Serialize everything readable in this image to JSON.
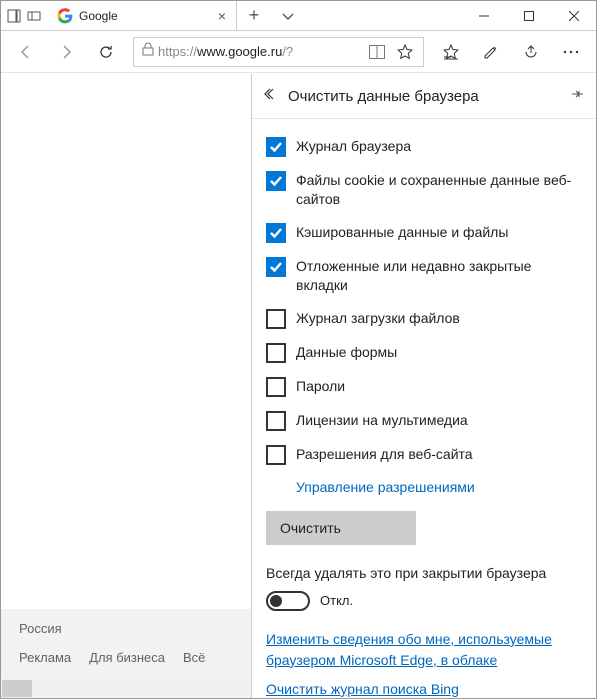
{
  "titlebar": {
    "tab_title": "Google",
    "new_tab": "+"
  },
  "addr": {
    "scheme": "https://",
    "host": "www.google.ru",
    "path": "/?"
  },
  "footer": {
    "country": "Россия",
    "link1": "Реклама",
    "link2": "Для бизнеса",
    "link3": "Всё"
  },
  "panel": {
    "title": "Очистить данные браузера",
    "items": [
      {
        "label": "Журнал браузера",
        "checked": true
      },
      {
        "label": "Файлы cookie и сохраненные данные веб-сайтов",
        "checked": true
      },
      {
        "label": "Кэшированные данные и файлы",
        "checked": true
      },
      {
        "label": "Отложенные или недавно закрытые вкладки",
        "checked": true
      },
      {
        "label": "Журнал загрузки файлов",
        "checked": false
      },
      {
        "label": "Данные формы",
        "checked": false
      },
      {
        "label": "Пароли",
        "checked": false
      },
      {
        "label": "Лицензии на мультимедиа",
        "checked": false
      },
      {
        "label": "Разрешения для веб-сайта",
        "checked": false
      }
    ],
    "manage_link": "Управление разрешениями",
    "clear_button": "Очистить",
    "always_label": "Всегда удалять это при закрытии браузера",
    "toggle_state": "Откл.",
    "edit_link": "Изменить сведения обо мне, используемые браузером Microsoft Edge, в облаке",
    "bing_link": "Очистить журнал поиска Bing"
  }
}
